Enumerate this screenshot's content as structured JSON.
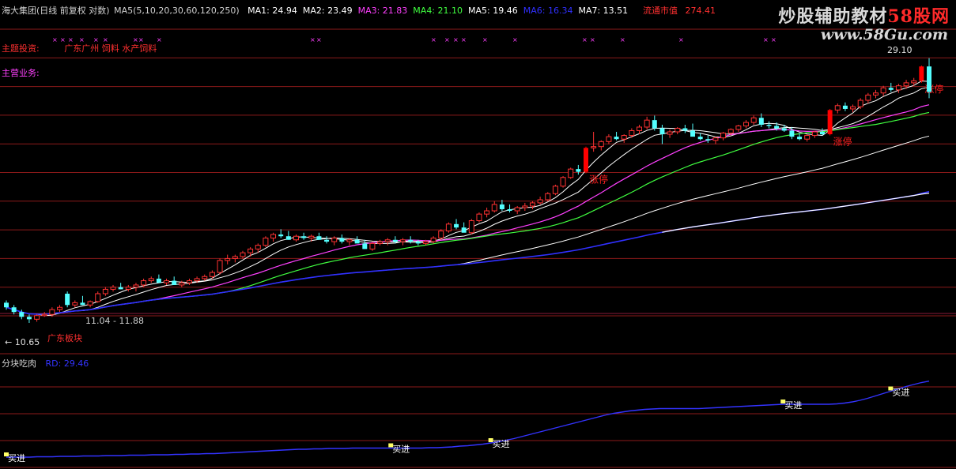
{
  "header": {
    "title": "海大集团(日线 前复权 对数)",
    "ma_def": "MA5(5,10,20,30,60,120,250)",
    "ma_values": [
      {
        "label": "MA1: 24.94",
        "color": "#ffffff"
      },
      {
        "label": "MA2: 23.49",
        "color": "#ffffff"
      },
      {
        "label": "MA3: 21.83",
        "color": "#ff40ff"
      },
      {
        "label": "MA4: 21.10",
        "color": "#40ff40"
      },
      {
        "label": "MA5: 19.46",
        "color": "#ffffff"
      },
      {
        "label": "MA6: 16.34",
        "color": "#3030ff"
      },
      {
        "label": "MA7: 13.51",
        "color": "#ffffff"
      }
    ],
    "market_cap_label": "流通市值",
    "market_cap_value": "274.41"
  },
  "info": {
    "concept_label": "主题投资:",
    "concept_value": "广东广州 饲料 水产饲料",
    "business_label": "主营业务:"
  },
  "watermark": {
    "line1_a": "炒股辅助教材",
    "line1_b": "58股网",
    "line2": "www.58Gu.com"
  },
  "colors": {
    "up": "#ff3232",
    "down": "#54ffff",
    "limit_up": "#ff0000",
    "ma1": "#ffffff",
    "ma2": "#ffffff",
    "ma3": "#ff40ff",
    "ma4": "#40ff40",
    "ma5": "#ffffff",
    "ma6": "#3030ff",
    "ma7": "#ffffff",
    "grid": "#8b1a1a",
    "indicator_line": "#3333ff",
    "signal": "#ffff66"
  },
  "chart_data": {
    "type": "candlestick",
    "scale": "log",
    "main_price_range": [
      10.0,
      30.5
    ],
    "price_annotations": {
      "high": "29.10",
      "low": "10.65",
      "range_text": "11.04 - 11.88",
      "bottom_tag": "广东板块"
    },
    "limit_up_label": "涨停",
    "candles": [
      [
        11.5,
        11.6,
        11.2,
        11.3
      ],
      [
        11.3,
        11.4,
        11.0,
        11.1
      ],
      [
        11.1,
        11.2,
        10.8,
        10.9
      ],
      [
        10.9,
        11.0,
        10.65,
        10.8
      ],
      [
        10.8,
        11.0,
        10.7,
        10.95
      ],
      [
        10.95,
        11.1,
        10.9,
        11.0
      ],
      [
        11.0,
        11.3,
        10.9,
        11.2
      ],
      [
        11.2,
        11.4,
        11.1,
        11.3
      ],
      [
        11.9,
        12.0,
        11.3,
        11.4
      ],
      [
        11.4,
        11.6,
        11.3,
        11.5
      ],
      [
        11.5,
        11.8,
        11.4,
        11.4
      ],
      [
        11.4,
        11.6,
        11.3,
        11.55
      ],
      [
        11.55,
        12.0,
        11.5,
        11.9
      ],
      [
        11.9,
        12.2,
        11.8,
        12.1
      ],
      [
        12.1,
        12.3,
        12.0,
        12.2
      ],
      [
        12.2,
        12.4,
        12.1,
        12.1
      ],
      [
        12.1,
        12.3,
        12.0,
        12.2
      ],
      [
        12.2,
        12.4,
        12.0,
        12.3
      ],
      [
        12.3,
        12.6,
        12.2,
        12.5
      ],
      [
        12.5,
        12.7,
        12.4,
        12.6
      ],
      [
        12.6,
        12.8,
        12.5,
        12.4
      ],
      [
        12.4,
        12.6,
        12.3,
        12.5
      ],
      [
        12.5,
        12.7,
        12.3,
        12.3
      ],
      [
        12.3,
        12.5,
        12.2,
        12.4
      ],
      [
        12.4,
        12.6,
        12.3,
        12.5
      ],
      [
        12.5,
        12.7,
        12.4,
        12.6
      ],
      [
        12.6,
        12.8,
        12.5,
        12.7
      ],
      [
        12.7,
        13.0,
        12.6,
        12.9
      ],
      [
        12.9,
        13.6,
        12.8,
        13.5
      ],
      [
        13.5,
        13.8,
        13.3,
        13.6
      ],
      [
        13.6,
        13.8,
        13.4,
        13.7
      ],
      [
        13.7,
        14.0,
        13.6,
        13.9
      ],
      [
        13.9,
        14.2,
        13.7,
        14.1
      ],
      [
        14.1,
        14.4,
        13.9,
        14.3
      ],
      [
        14.3,
        14.8,
        14.2,
        14.7
      ],
      [
        14.7,
        15.0,
        14.5,
        14.9
      ],
      [
        14.9,
        15.2,
        14.7,
        14.8
      ],
      [
        14.8,
        15.1,
        14.6,
        14.6
      ],
      [
        14.6,
        14.9,
        14.5,
        14.8
      ],
      [
        14.8,
        15.0,
        14.6,
        14.7
      ],
      [
        14.7,
        14.9,
        14.5,
        14.8
      ],
      [
        14.8,
        15.0,
        14.6,
        14.6
      ],
      [
        14.6,
        14.8,
        14.4,
        14.5
      ],
      [
        14.5,
        14.8,
        14.3,
        14.7
      ],
      [
        14.7,
        14.9,
        14.4,
        14.5
      ],
      [
        14.5,
        14.7,
        14.3,
        14.6
      ],
      [
        14.6,
        14.8,
        14.5,
        14.4
      ],
      [
        14.4,
        14.6,
        14.1,
        14.1
      ],
      [
        14.1,
        14.5,
        14.0,
        14.4
      ],
      [
        14.4,
        14.6,
        14.3,
        14.5
      ],
      [
        14.5,
        14.7,
        14.3,
        14.6
      ],
      [
        14.6,
        14.8,
        14.4,
        14.5
      ],
      [
        14.5,
        14.7,
        14.3,
        14.6
      ],
      [
        14.6,
        14.8,
        14.4,
        14.5
      ],
      [
        14.5,
        14.6,
        14.3,
        14.4
      ],
      [
        14.4,
        14.6,
        14.3,
        14.5
      ],
      [
        14.5,
        14.8,
        14.4,
        14.7
      ],
      [
        14.7,
        15.2,
        14.6,
        15.1
      ],
      [
        15.1,
        15.6,
        15.0,
        15.5
      ],
      [
        15.5,
        15.8,
        15.2,
        15.3
      ],
      [
        15.3,
        15.6,
        15.1,
        15.0
      ],
      [
        15.0,
        15.8,
        14.9,
        15.7
      ],
      [
        15.7,
        16.2,
        15.6,
        16.1
      ],
      [
        16.1,
        16.5,
        15.9,
        16.3
      ],
      [
        16.3,
        16.9,
        16.2,
        16.7
      ],
      [
        16.7,
        17.0,
        16.3,
        16.4
      ],
      [
        16.4,
        16.7,
        16.2,
        16.3
      ],
      [
        16.3,
        16.6,
        16.1,
        16.5
      ],
      [
        16.5,
        16.8,
        16.3,
        16.6
      ],
      [
        16.6,
        16.9,
        16.4,
        16.8
      ],
      [
        16.8,
        17.2,
        16.7,
        17.0
      ],
      [
        17.0,
        17.5,
        16.9,
        17.4
      ],
      [
        17.4,
        18.0,
        17.3,
        17.9
      ],
      [
        17.9,
        18.6,
        17.8,
        18.5
      ],
      [
        18.5,
        19.2,
        18.4,
        19.1
      ],
      [
        19.1,
        19.4,
        18.7,
        18.9
      ],
      [
        18.9,
        20.8,
        18.8,
        20.7
      ],
      [
        20.7,
        22.0,
        20.4,
        20.8
      ],
      [
        20.8,
        21.3,
        20.5,
        21.2
      ],
      [
        21.2,
        21.8,
        21.0,
        21.6
      ],
      [
        21.6,
        22.0,
        21.3,
        21.4
      ],
      [
        21.4,
        21.8,
        21.1,
        21.7
      ],
      [
        21.7,
        22.3,
        21.5,
        22.1
      ],
      [
        22.1,
        22.6,
        21.8,
        22.4
      ],
      [
        22.4,
        23.3,
        22.2,
        23.0
      ],
      [
        23.0,
        23.4,
        22.1,
        22.3
      ],
      [
        22.3,
        22.6,
        21.0,
        21.8
      ],
      [
        21.8,
        22.2,
        21.5,
        22.0
      ],
      [
        22.0,
        22.4,
        21.8,
        22.3
      ],
      [
        22.3,
        22.6,
        21.9,
        22.1
      ],
      [
        22.1,
        22.7,
        21.7,
        21.6
      ],
      [
        21.6,
        21.9,
        21.3,
        21.4
      ],
      [
        21.4,
        21.7,
        21.1,
        21.3
      ],
      [
        21.3,
        21.6,
        21.0,
        21.5
      ],
      [
        21.5,
        22.0,
        21.3,
        21.9
      ],
      [
        21.9,
        22.3,
        21.7,
        22.2
      ],
      [
        22.2,
        22.6,
        22.0,
        22.5
      ],
      [
        22.5,
        23.0,
        22.3,
        22.8
      ],
      [
        22.8,
        23.4,
        22.6,
        23.2
      ],
      [
        23.2,
        23.6,
        22.4,
        22.6
      ],
      [
        22.6,
        22.9,
        22.3,
        22.5
      ],
      [
        22.5,
        22.8,
        22.1,
        22.3
      ],
      [
        22.3,
        22.6,
        22.0,
        22.1
      ],
      [
        22.1,
        22.4,
        21.4,
        21.6
      ],
      [
        21.6,
        21.9,
        21.3,
        21.4
      ],
      [
        21.4,
        21.8,
        21.2,
        21.7
      ],
      [
        21.7,
        22.1,
        21.5,
        22.0
      ],
      [
        22.0,
        22.3,
        21.7,
        21.8
      ],
      [
        21.8,
        24.0,
        21.7,
        23.9
      ],
      [
        23.9,
        24.5,
        23.6,
        24.3
      ],
      [
        24.3,
        24.6,
        23.8,
        24.0
      ],
      [
        24.0,
        24.4,
        23.7,
        24.2
      ],
      [
        24.2,
        25.0,
        24.0,
        24.8
      ],
      [
        24.8,
        25.5,
        24.5,
        25.3
      ],
      [
        25.3,
        25.8,
        25.0,
        25.5
      ],
      [
        25.5,
        26.2,
        25.2,
        26.0
      ],
      [
        26.0,
        26.5,
        25.6,
        25.8
      ],
      [
        25.8,
        26.4,
        25.5,
        26.2
      ],
      [
        26.2,
        26.8,
        25.9,
        26.5
      ],
      [
        26.5,
        27.0,
        26.2,
        26.7
      ],
      [
        26.7,
        28.3,
        26.5,
        28.2
      ],
      [
        28.2,
        29.1,
        25.0,
        25.6
      ]
    ],
    "limit_up_indices": [
      76,
      108,
      120
    ]
  },
  "indicator": {
    "name": "分块吃肉",
    "value_label": "RD: 29.46",
    "signal_label": "买进",
    "y_range": [
      8,
      32
    ],
    "values_all": [
      10.2,
      10.2,
      10.2,
      10.2,
      10.3,
      10.3,
      10.3,
      10.4,
      10.4,
      10.4,
      10.5,
      10.5,
      10.5,
      10.6,
      10.6,
      10.6,
      10.7,
      10.7,
      10.7,
      10.8,
      10.8,
      10.8,
      10.9,
      10.9,
      11.0,
      11.0,
      11.1,
      11.1,
      11.2,
      11.3,
      11.4,
      11.5,
      11.6,
      11.7,
      11.8,
      11.9,
      12.0,
      12.1,
      12.2,
      12.2,
      12.3,
      12.3,
      12.4,
      12.4,
      12.4,
      12.5,
      12.5,
      12.5,
      12.5,
      12.5,
      12.5,
      12.5,
      12.5,
      12.5,
      12.5,
      12.6,
      12.6,
      12.7,
      12.8,
      13.0,
      13.1,
      13.3,
      13.5,
      13.8,
      14.1,
      14.5,
      14.9,
      15.4,
      15.9,
      16.4,
      16.9,
      17.4,
      17.9,
      18.4,
      18.9,
      19.4,
      19.9,
      20.4,
      20.9,
      21.3,
      21.6,
      21.9,
      22.1,
      22.3,
      22.4,
      22.5,
      22.5,
      22.5,
      22.5,
      22.5,
      22.5,
      22.6,
      22.7,
      22.8,
      22.9,
      23.0,
      23.1,
      23.2,
      23.3,
      23.4,
      23.5,
      23.6,
      23.6,
      23.6,
      23.6,
      23.6,
      23.6,
      23.6,
      23.7,
      23.9,
      24.2,
      24.6,
      25.1,
      25.7,
      26.3,
      26.9,
      27.5,
      28.1,
      28.6,
      29.1,
      29.46
    ],
    "signals": [
      0,
      50,
      63,
      101,
      115
    ]
  }
}
